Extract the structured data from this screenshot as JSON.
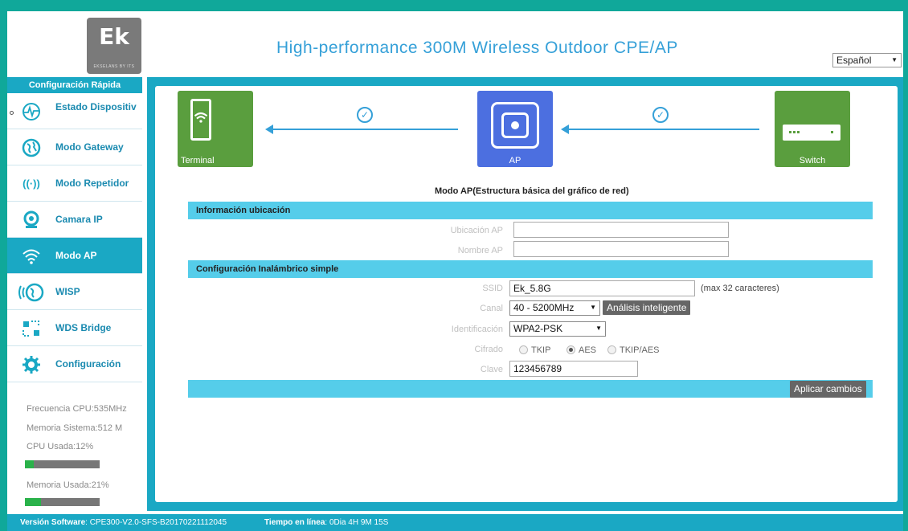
{
  "header": {
    "logo_text": "Ek",
    "logo_sub": "EKSELANS BY ITS",
    "title": "High-performance 300M Wireless Outdoor CPE/AP",
    "language": "Español"
  },
  "sidebar": {
    "heading": "Configuración Rápida",
    "items": [
      {
        "label": "Estado Dispositiv",
        "icon": "pulse-globe-icon"
      },
      {
        "label": "Modo Gateway",
        "icon": "globe-icon"
      },
      {
        "label": "Modo Repetidor",
        "icon": "antenna-icon"
      },
      {
        "label": "Camara IP",
        "icon": "camera-icon"
      },
      {
        "label": "Modo AP",
        "icon": "wifi-icon"
      },
      {
        "label": "WISP",
        "icon": "wisp-globe-icon"
      },
      {
        "label": "WDS Bridge",
        "icon": "bridge-icon"
      },
      {
        "label": "Configuración",
        "icon": "gear-icon"
      }
    ],
    "active_index": 4
  },
  "stats": {
    "cpu_freq": "Frecuencia CPU:535MHz",
    "memory": "Memoria Sistema:512 M",
    "cpu_used": "CPU Usada:12%",
    "cpu_used_fraction": 0.12,
    "mem_used": "Memoria Usada:21%",
    "mem_used_fraction": 0.21
  },
  "diagram": {
    "terminal_label": "Terminal",
    "ap_label": "AP",
    "switch_label": "Switch",
    "mode_title": "Modo AP(Estructura básica del gráfico de red)"
  },
  "location_section": {
    "title": "Información ubicación",
    "ap_location_label": "Ubicación AP",
    "ap_location_value": "",
    "ap_name_label": "Nombre AP",
    "ap_name_value": ""
  },
  "wireless_section": {
    "title": "Configuración Inalámbrico simple",
    "ssid_label": "SSID",
    "ssid_value": "Ek_5.8G",
    "ssid_hint": "(max 32 caracteres)",
    "channel_label": "Canal",
    "channel_value": "40 - 5200MHz",
    "smart_scan_button": "Análisis inteligente",
    "auth_label": "Identificación",
    "auth_value": "WPA2-PSK",
    "cipher_label": "Cifrado",
    "cipher_options": [
      "TKIP",
      "AES",
      "TKIP/AES"
    ],
    "cipher_selected": "AES",
    "key_label": "Clave",
    "key_value": "123456789",
    "apply_button": "Aplicar cambios"
  },
  "footer": {
    "software_label": "Versión Software",
    "software_value": ": CPE300-V2.0-SFS-B20170221112045",
    "uptime_label": "Tiempo en línea",
    "uptime_value": ": 0Dia 4H 9M 15S"
  }
}
